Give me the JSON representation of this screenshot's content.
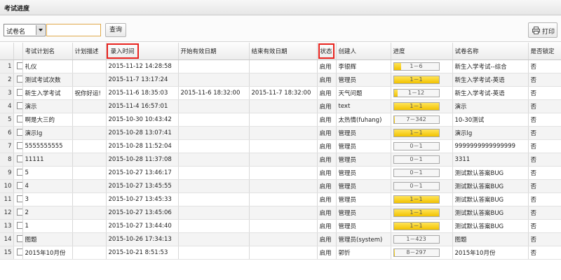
{
  "title": "考试进度",
  "toolbar": {
    "select_value": "试卷名",
    "search_value": "",
    "query_label": "查询",
    "print_label": "打印"
  },
  "columns": [
    "",
    "考试计划名",
    "计划描述",
    "录入时间",
    "开始有效日期",
    "结束有效日期",
    "状态",
    "创建人",
    "进度",
    "试卷名称",
    "是否锁定"
  ],
  "rows": [
    {
      "n": "1",
      "name": "礼仪",
      "desc": "",
      "entry": "2015-11-12 14:28:58",
      "start": "",
      "end": "",
      "status": "启用",
      "creator": "李银辉",
      "progress": "1－6",
      "done": 1,
      "total": 6,
      "paper": "新生入学考试--综合",
      "locked": "否"
    },
    {
      "n": "2",
      "name": "测试考试次数",
      "desc": "",
      "entry": "2015-11-7 13:17:24",
      "start": "",
      "end": "",
      "status": "启用",
      "creator": "管理员",
      "progress": "1－1",
      "done": 1,
      "total": 1,
      "paper": "新生入学考试-英语",
      "locked": "否"
    },
    {
      "n": "3",
      "name": "新生入学考试",
      "desc": "祝你好运!",
      "entry": "2015-11-6 18:35:03",
      "start": "2015-11-6 18:32:00",
      "end": "2015-11-7 18:32:00",
      "status": "启用",
      "creator": "天气问题",
      "progress": "1－12",
      "done": 1,
      "total": 12,
      "paper": "新生入学考试-英语",
      "locked": "否"
    },
    {
      "n": "4",
      "name": "演示",
      "desc": "",
      "entry": "2015-11-4 16:57:01",
      "start": "",
      "end": "",
      "status": "启用",
      "creator": "text",
      "progress": "1－1",
      "done": 1,
      "total": 1,
      "paper": "演示",
      "locked": "否"
    },
    {
      "n": "5",
      "name": "啊是大三的",
      "desc": "",
      "entry": "2015-10-30 10:43:42",
      "start": "",
      "end": "",
      "status": "启用",
      "creator": "太热情(fuhang)",
      "progress": "7－342",
      "done": 7,
      "total": 342,
      "paper": "10-30测试",
      "locked": "否"
    },
    {
      "n": "6",
      "name": "演示lg",
      "desc": "",
      "entry": "2015-10-28 13:07:41",
      "start": "",
      "end": "",
      "status": "启用",
      "creator": "管理员",
      "progress": "1－1",
      "done": 1,
      "total": 1,
      "paper": "演示lg",
      "locked": "否"
    },
    {
      "n": "7",
      "name": "5555555555",
      "desc": "",
      "entry": "2015-10-28 11:52:04",
      "start": "",
      "end": "",
      "status": "启用",
      "creator": "管理员",
      "progress": "0－1",
      "done": 0,
      "total": 1,
      "paper": "9999999999999999",
      "locked": "否"
    },
    {
      "n": "8",
      "name": "11111",
      "desc": "",
      "entry": "2015-10-28 11:37:08",
      "start": "",
      "end": "",
      "status": "启用",
      "creator": "管理员",
      "progress": "0－1",
      "done": 0,
      "total": 1,
      "paper": "3311",
      "locked": "否"
    },
    {
      "n": "9",
      "name": "5",
      "desc": "",
      "entry": "2015-10-27 13:46:17",
      "start": "",
      "end": "",
      "status": "启用",
      "creator": "管理员",
      "progress": "0－1",
      "done": 0,
      "total": 1,
      "paper": "测试默认答案BUG",
      "locked": "否"
    },
    {
      "n": "10",
      "name": "4",
      "desc": "",
      "entry": "2015-10-27 13:45:55",
      "start": "",
      "end": "",
      "status": "启用",
      "creator": "管理员",
      "progress": "0－1",
      "done": 0,
      "total": 1,
      "paper": "测试默认答案BUG",
      "locked": "否"
    },
    {
      "n": "11",
      "name": "3",
      "desc": "",
      "entry": "2015-10-27 13:45:33",
      "start": "",
      "end": "",
      "status": "启用",
      "creator": "管理员",
      "progress": "1－1",
      "done": 1,
      "total": 1,
      "paper": "测试默认答案BUG",
      "locked": "否"
    },
    {
      "n": "12",
      "name": "2",
      "desc": "",
      "entry": "2015-10-27 13:45:06",
      "start": "",
      "end": "",
      "status": "启用",
      "creator": "管理员",
      "progress": "1－1",
      "done": 1,
      "total": 1,
      "paper": "测试默认答案BUG",
      "locked": "否"
    },
    {
      "n": "13",
      "name": "1",
      "desc": "",
      "entry": "2015-10-27 13:44:40",
      "start": "",
      "end": "",
      "status": "启用",
      "creator": "管理员",
      "progress": "1－1",
      "done": 1,
      "total": 1,
      "paper": "测试默认答案BUG",
      "locked": "否"
    },
    {
      "n": "14",
      "name": "图题",
      "desc": "",
      "entry": "2015-10-26 17:34:13",
      "start": "",
      "end": "",
      "status": "启用",
      "creator": "管理员(system)",
      "progress": "1－423",
      "done": 1,
      "total": 423,
      "paper": "图题",
      "locked": "否"
    },
    {
      "n": "15",
      "name": "2015年10月份",
      "desc": "",
      "entry": "2015-10-21 8:51:53",
      "start": "",
      "end": "",
      "status": "启用",
      "creator": "郭忻",
      "progress": "8－297",
      "done": 8,
      "total": 297,
      "paper": "2015年10月份",
      "locked": "否"
    }
  ]
}
